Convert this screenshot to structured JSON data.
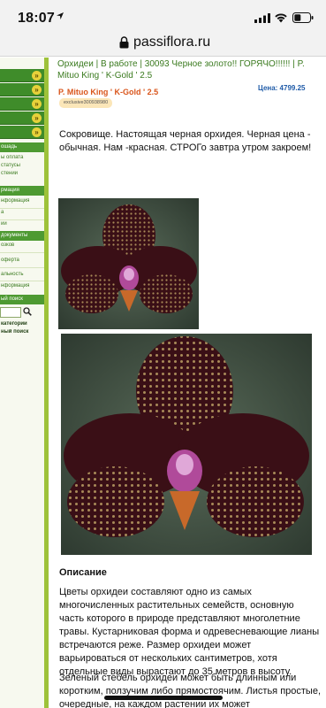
{
  "status_bar": {
    "time": "18:07",
    "icons": [
      "location-arrow-icon",
      "signal-bars-icon",
      "wifi-icon",
      "battery-icon"
    ]
  },
  "browser": {
    "url": "passiflora.ru",
    "icons": [
      "lock-icon"
    ]
  },
  "sidebar": {
    "menu_arrow_glyph": "»",
    "sections": [
      {
        "header": "ошадь",
        "links": [
          "ы оплата",
          "статусы",
          "стений"
        ]
      },
      {
        "header": "рмация",
        "links": [
          "нформация",
          "а",
          "ии"
        ]
      },
      {
        "header": "документы",
        "links": [
          "озков",
          "оферта",
          "альность",
          "нформация"
        ]
      },
      {
        "header": "ый поиск",
        "links": []
      }
    ],
    "search_extra": [
      "категории",
      "ный поиск"
    ],
    "icons": [
      "search-icon"
    ]
  },
  "breadcrumb": {
    "items": [
      "Орхидеи",
      "В работе",
      "30093 Черное золото!! ГОРЯЧО!!!!!!",
      "P. Mituo King ' K-Gold ' 2.5"
    ],
    "separator": " | "
  },
  "product": {
    "title": "P. Mituo King ' K-Gold ' 2.5",
    "price": "Цена: 4799.25",
    "sku": "exclusive300938980",
    "description": "Сокровище. Настоящая черная орхидея. Черная цена - обычная. Нам -красная. СТРОГо завтра утром закроем!"
  },
  "images": [
    {
      "alt": "orchid-photo-small"
    },
    {
      "alt": "orchid-photo-large"
    }
  ],
  "content": {
    "heading": "Описание",
    "paragraph_1": "Цветы орхидеи составляют одно из самых многочисленных растительных семейств, основную часть которого в природе представляют многолетние травы. Кустарниковая форма и одревесневающие лианы встречаются реже. Размер орхидеи может варьироваться от нескольких сантиметров, хотя отдельные виды вырастают до 35 метров в высоту.",
    "paragraph_2": "Зеленый стебель орхидеи может быть длинным или коротким, ползучим либо прямостоячим. Листья простые, очередные, на каждом растении их может"
  },
  "colors": {
    "link_green": "#3a7a1e",
    "title_orange": "#d9551b",
    "price_blue": "#1f5ba8",
    "sidebar_green": "#3f8c2a",
    "sidebar_border": "#9ec23a",
    "orchid_dark": "#3a0f16"
  }
}
